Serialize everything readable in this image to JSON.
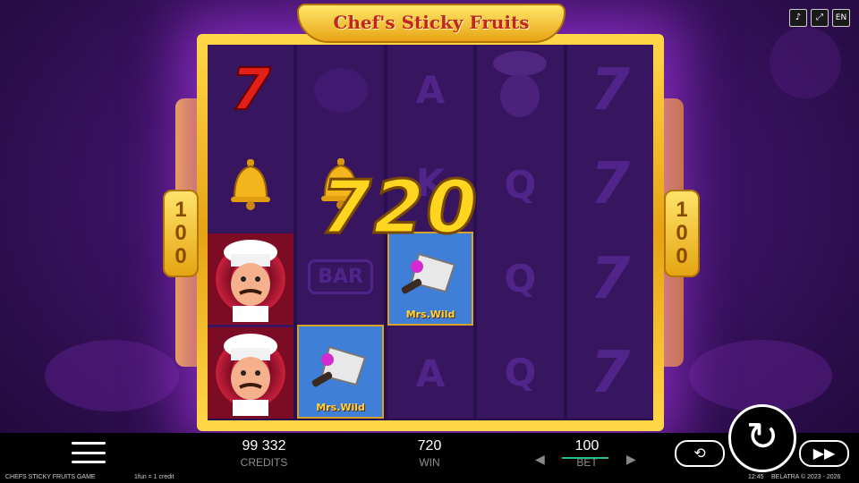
{
  "game": {
    "title": "Chef's Sticky Fruits",
    "footer_name": "CHEFS STICKY FRUITS GAME",
    "rate_note": "1fun = 1 credit",
    "time": "12:45",
    "copyright": "BELATRA © 2023 - 2026"
  },
  "controls": {
    "sound_icon": "speaker-icon",
    "fullscreen_icon": "fullscreen-icon",
    "language": "EN"
  },
  "pay_plates": {
    "left": [
      "1",
      "0",
      "0"
    ],
    "right": [
      "1",
      "0",
      "0"
    ]
  },
  "reels": [
    [
      "seven-red",
      "bell",
      "chef",
      "chef"
    ],
    [
      "plum",
      "bell",
      "bar",
      "wild"
    ],
    [
      "A",
      "K",
      "wild",
      "A"
    ],
    [
      "chef-ghost",
      "Q",
      "Q",
      "Q"
    ],
    [
      "7",
      "7",
      "7",
      "7"
    ]
  ],
  "symbols": {
    "bar_text": "BAR",
    "wild_text": "Mrs.Wild",
    "seven_text": "7"
  },
  "win_display": "720",
  "stats": {
    "credits_value": "99 332",
    "credits_label": "CREDITS",
    "win_value": "720",
    "win_label": "WIN",
    "bet_value": "100",
    "bet_label": "BET"
  },
  "buttons": {
    "menu": "menu-icon",
    "autoplay": "⟲",
    "spin": "↻",
    "turbo": "▶▶"
  },
  "colors": {
    "frame_gold": "#f2b523",
    "background_purple": "#3d1366",
    "win_yellow": "#ffd61f",
    "bet_accent": "#22c08a"
  }
}
